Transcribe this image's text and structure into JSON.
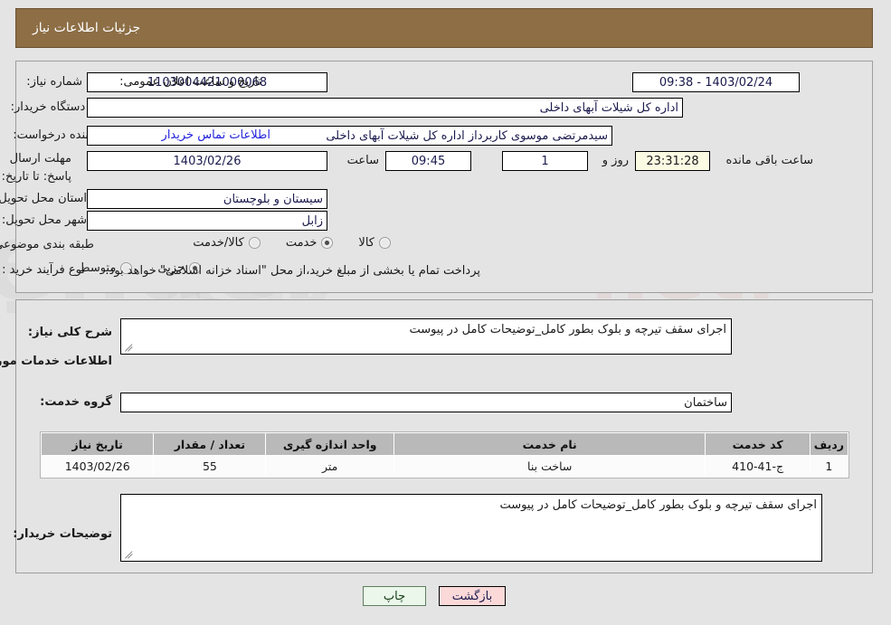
{
  "header": {
    "title": "جزئیات اطلاعات نیاز",
    "bg_color": "#8d6e45",
    "text_color": "#ffffff"
  },
  "top_panel": {
    "fields": {
      "need_number_label": "شماره نیاز:",
      "need_number_value": "1103004421000068",
      "buyer_org_label": "نام دستگاه خریدار:",
      "buyer_org_value": "اداره کل شیلات آبهای داخلی",
      "creator_label": "ایجاد کننده درخواست:",
      "creator_value": "سیدمرتضی موسوی کاربرداز اداره کل شیلات آبهای داخلی",
      "deadline_label": "مهلت ارسال پاسخ: تا تاریخ:",
      "deadline_date": "1403/02/26",
      "time_label": "ساعت",
      "time_value": "09:45",
      "days_value": "1",
      "days_label": "روز و",
      "countdown_value": "23:31:28",
      "countdown_label": "ساعت باقی مانده",
      "announce_label": "تاریخ و ساعت اعلان عمومی:",
      "announce_value": "1403/02/24 - 09:38",
      "contact_link": "اطلاعات تماس خریدار",
      "province_label": "استان محل تحویل:",
      "province_value": "سیستان و بلوچستان",
      "city_label": "شهر محل تحویل:",
      "city_value": "زابل",
      "category_label": "طبقه بندی موضوعی:",
      "process_label": "نوع فرآیند خرید :",
      "treasury_note": "پرداخت تمام یا بخشی از مبلغ خرید،از محل \"اسناد خزانه اسلامی\" خواهد بود."
    },
    "category_options": [
      {
        "label": "کالا",
        "selected": false
      },
      {
        "label": "خدمت",
        "selected": true
      },
      {
        "label": "کالا/خدمت",
        "selected": false
      }
    ],
    "process_options": [
      {
        "label": "جزیی",
        "selected": true
      },
      {
        "label": "متوسط",
        "selected": false
      }
    ]
  },
  "bottom_panel": {
    "summary_label": "شرح کلی نیاز:",
    "summary_value": "اجرای سقف تیرچه و بلوک بطور کامل_توضیحات کامل  در پیوست",
    "services_heading": "اطلاعات خدمات مورد نیاز",
    "service_group_label": "گروه خدمت:",
    "service_group_value": "ساختمان",
    "buyer_notes_label": "توضیحات خریدار:",
    "buyer_notes_value": "اجرای سقف تیرچه و بلوک بطور کامل_توضیحات کامل  در پیوست",
    "table": {
      "headers": [
        "ردیف",
        "کد خدمت",
        "نام خدمت",
        "واحد اندازه گیری",
        "تعداد / مقدار",
        "تاریخ نیاز"
      ],
      "rows": [
        [
          "1",
          "ج-41-410",
          "ساخت بنا",
          "متر",
          "55",
          "1403/02/26"
        ]
      ]
    }
  },
  "footer": {
    "print_label": "چاپ",
    "back_label": "بازگشت"
  },
  "watermark": {
    "text": "AnaTender.net"
  }
}
